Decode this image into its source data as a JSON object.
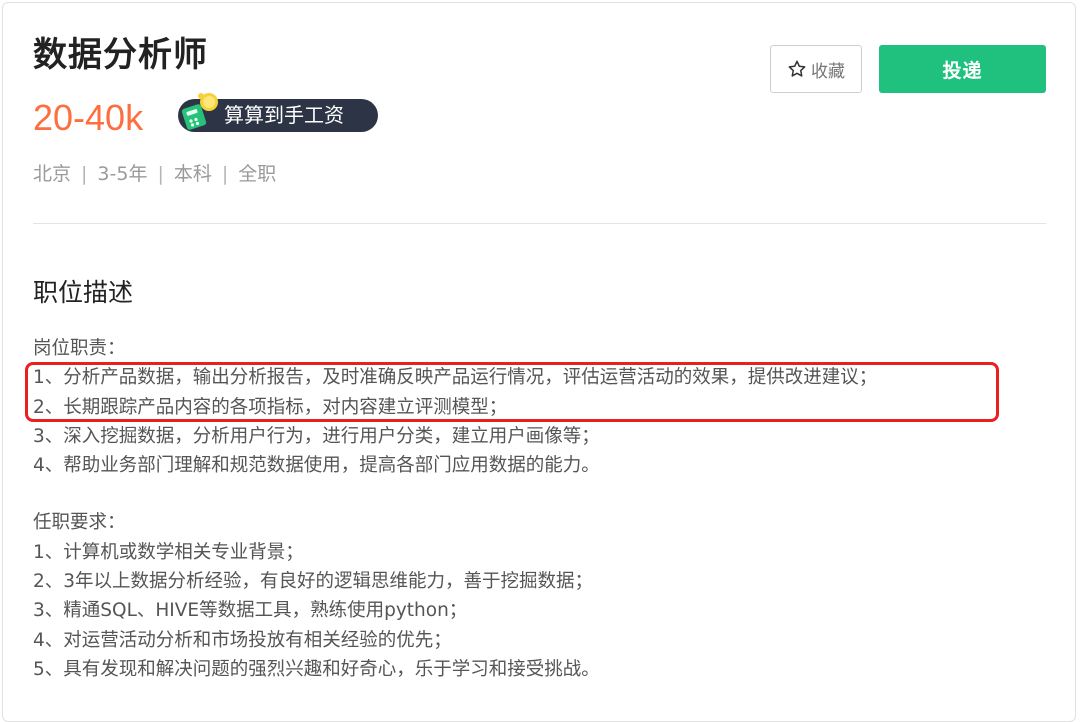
{
  "job": {
    "title": "数据分析师",
    "salary": "20-40k",
    "calc_badge_label": "算算到手工资",
    "meta": {
      "city": "北京",
      "experience": "3-5年",
      "education": "本科",
      "job_type": "全职",
      "separator": "|"
    }
  },
  "actions": {
    "favorite_label": "收藏",
    "apply_label": "投递"
  },
  "description": {
    "section_title": "职位描述",
    "responsibilities_heading": "岗位职责：",
    "responsibilities": [
      "1、分析产品数据，输出分析报告，及时准确反映产品运行情况，评估运营活动的效果，提供改进建议；",
      "2、长期跟踪产品内容的各项指标，对内容建立评测模型；",
      "3、深入挖掘数据，分析用户行为，进行用户分类，建立用户画像等；",
      "4、帮助业务部门理解和规范数据使用，提高各部门应用数据的能力。"
    ],
    "requirements_heading": "任职要求：",
    "requirements": [
      "1、计算机或数学相关专业背景；",
      "2、3年以上数据分析经验，有良好的逻辑思维能力，善于挖掘数据；",
      "3、精通SQL、HIVE等数据工具，熟练使用python；",
      "4、对运营活动分析和市场投放有相关经验的优先；",
      "5、具有发现和解决问题的强烈兴趣和好奇心，乐于学习和接受挑战。"
    ]
  },
  "colors": {
    "salary": "#fe6f40",
    "apply_button": "#20c17f",
    "highlight": "#e8211d",
    "badge_bg": "#2d3446"
  },
  "icons": {
    "favorite": "star-outline-icon",
    "calculator": "calculator-coin-icon"
  }
}
